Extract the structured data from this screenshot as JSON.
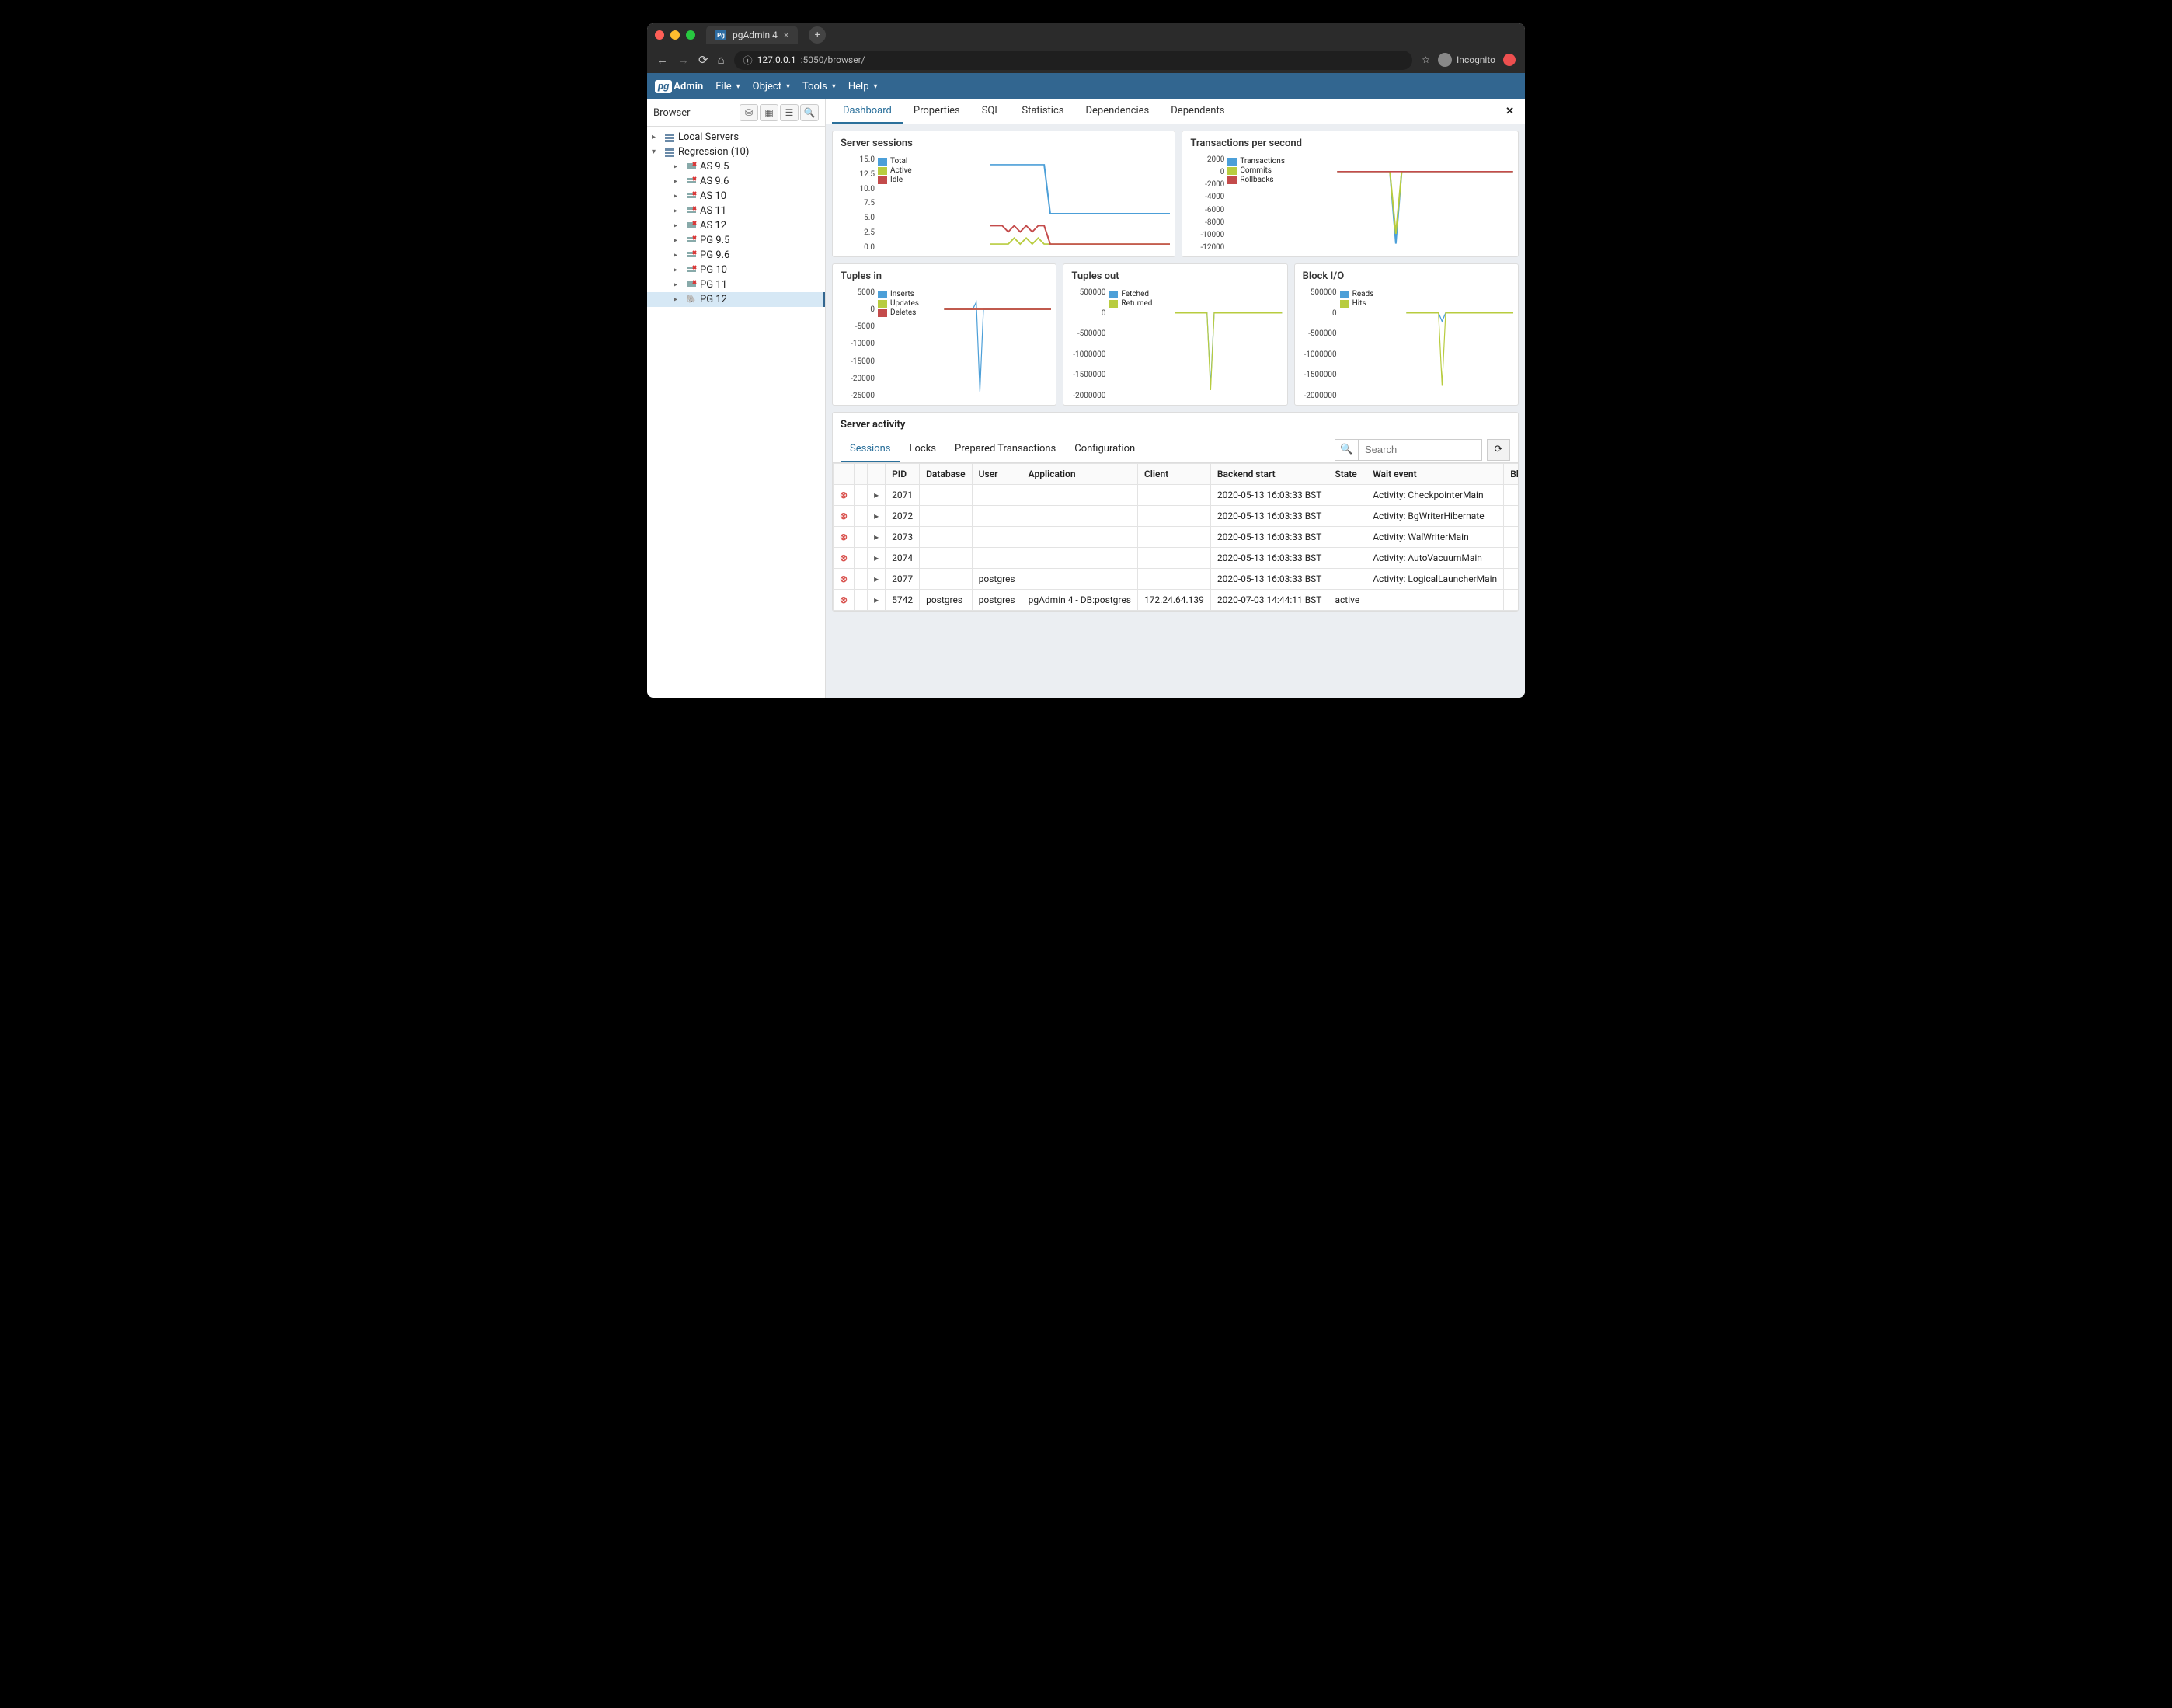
{
  "browser": {
    "tab_title": "pgAdmin 4",
    "url_display_prefix": "127.0.0.1",
    "url_display_suffix": ":5050/browser/",
    "incognito_label": "Incognito"
  },
  "appbar": {
    "brand_pg": "pg",
    "brand_admin": "Admin",
    "menus": [
      "File",
      "Object",
      "Tools",
      "Help"
    ]
  },
  "sidebar": {
    "title": "Browser",
    "tree": [
      {
        "label": "Local Servers",
        "indent": 0,
        "expanded": false,
        "icon": "group"
      },
      {
        "label": "Regression (10)",
        "indent": 0,
        "expanded": true,
        "icon": "group"
      },
      {
        "label": "AS 9.5",
        "indent": 2,
        "icon": "server-off"
      },
      {
        "label": "AS 9.6",
        "indent": 2,
        "icon": "server-off"
      },
      {
        "label": "AS 10",
        "indent": 2,
        "icon": "server-off"
      },
      {
        "label": "AS 11",
        "indent": 2,
        "icon": "server-off"
      },
      {
        "label": "AS 12",
        "indent": 2,
        "icon": "server-off"
      },
      {
        "label": "PG 9.5",
        "indent": 2,
        "icon": "server-off"
      },
      {
        "label": "PG 9.6",
        "indent": 2,
        "icon": "server-off"
      },
      {
        "label": "PG 10",
        "indent": 2,
        "icon": "server-off"
      },
      {
        "label": "PG 11",
        "indent": 2,
        "icon": "server-off"
      },
      {
        "label": "PG 12",
        "indent": 2,
        "icon": "elephant",
        "selected": true
      }
    ]
  },
  "main_tabs": [
    "Dashboard",
    "Properties",
    "SQL",
    "Statistics",
    "Dependencies",
    "Dependents"
  ],
  "charts": {
    "sessions": {
      "title": "Server sessions",
      "legend": [
        {
          "label": "Total",
          "color": "#4c9fd8"
        },
        {
          "label": "Active",
          "color": "#b8cc3f"
        },
        {
          "label": "Idle",
          "color": "#c44b4b"
        }
      ],
      "yticks": [
        "15.0",
        "12.5",
        "10.0",
        "7.5",
        "5.0",
        "2.5",
        "0.0"
      ]
    },
    "tps": {
      "title": "Transactions per second",
      "legend": [
        {
          "label": "Transactions",
          "color": "#4c9fd8"
        },
        {
          "label": "Commits",
          "color": "#b8cc3f"
        },
        {
          "label": "Rollbacks",
          "color": "#c44b4b"
        }
      ],
      "yticks": [
        "2000",
        "0",
        "-2000",
        "-4000",
        "-6000",
        "-8000",
        "-10000",
        "-12000"
      ]
    },
    "tin": {
      "title": "Tuples in",
      "legend": [
        {
          "label": "Inserts",
          "color": "#4c9fd8"
        },
        {
          "label": "Updates",
          "color": "#b8cc3f"
        },
        {
          "label": "Deletes",
          "color": "#c44b4b"
        }
      ],
      "yticks": [
        "5000",
        "0",
        "-5000",
        "-10000",
        "-15000",
        "-20000",
        "-25000"
      ]
    },
    "tout": {
      "title": "Tuples out",
      "legend": [
        {
          "label": "Fetched",
          "color": "#4c9fd8"
        },
        {
          "label": "Returned",
          "color": "#b8cc3f"
        }
      ],
      "yticks": [
        "500000",
        "0",
        "-500000",
        "-1000000",
        "-1500000",
        "-2000000"
      ]
    },
    "bio": {
      "title": "Block I/O",
      "legend": [
        {
          "label": "Reads",
          "color": "#4c9fd8"
        },
        {
          "label": "Hits",
          "color": "#b8cc3f"
        }
      ],
      "yticks": [
        "500000",
        "0",
        "-500000",
        "-1000000",
        "-1500000",
        "-2000000"
      ]
    }
  },
  "chart_data": [
    {
      "type": "line",
      "title": "Server sessions",
      "xlabel": "",
      "ylabel": "",
      "ylim": [
        0,
        15
      ],
      "series": [
        {
          "name": "Total",
          "color": "#4c9fd8",
          "values": [
            null,
            null,
            null,
            null,
            null,
            null,
            null,
            null,
            null,
            null,
            null,
            null,
            null,
            null,
            null,
            null,
            null,
            null,
            null,
            14,
            14,
            14,
            14,
            14,
            14,
            14,
            14,
            14,
            14,
            6,
            6,
            6,
            6,
            6,
            6,
            6,
            6,
            6,
            6,
            6,
            6,
            6,
            6,
            6,
            6,
            6,
            6,
            6,
            6,
            6
          ]
        },
        {
          "name": "Active",
          "color": "#b8cc3f",
          "values": [
            null,
            null,
            null,
            null,
            null,
            null,
            null,
            null,
            null,
            null,
            null,
            null,
            null,
            null,
            null,
            null,
            null,
            null,
            null,
            1,
            1,
            1,
            1,
            2,
            1,
            2,
            1,
            2,
            1,
            1,
            1,
            1,
            1,
            1,
            1,
            1,
            1,
            1,
            1,
            1,
            1,
            1,
            1,
            1,
            1,
            1,
            1,
            1,
            1,
            1
          ]
        },
        {
          "name": "Idle",
          "color": "#c44b4b",
          "values": [
            null,
            null,
            null,
            null,
            null,
            null,
            null,
            null,
            null,
            null,
            null,
            null,
            null,
            null,
            null,
            null,
            null,
            null,
            null,
            4,
            4,
            4,
            3,
            4,
            3,
            4,
            3,
            4,
            4,
            1,
            1,
            1,
            1,
            1,
            1,
            1,
            1,
            1,
            1,
            1,
            1,
            1,
            1,
            1,
            1,
            1,
            1,
            1,
            1,
            1
          ]
        }
      ]
    },
    {
      "type": "line",
      "title": "Transactions per second",
      "xlabel": "",
      "ylabel": "",
      "ylim": [
        -12000,
        2000
      ],
      "series": [
        {
          "name": "Transactions",
          "color": "#4c9fd8",
          "values": [
            null,
            null,
            null,
            null,
            null,
            null,
            null,
            null,
            null,
            null,
            null,
            null,
            null,
            null,
            null,
            null,
            null,
            null,
            null,
            0,
            0,
            0,
            0,
            0,
            0,
            0,
            0,
            0,
            0,
            -11000,
            0,
            0,
            0,
            0,
            0,
            0,
            0,
            0,
            0,
            0,
            0,
            0,
            0,
            0,
            0,
            0,
            0,
            0,
            0,
            0
          ]
        },
        {
          "name": "Commits",
          "color": "#b8cc3f",
          "values": [
            null,
            null,
            null,
            null,
            null,
            null,
            null,
            null,
            null,
            null,
            null,
            null,
            null,
            null,
            null,
            null,
            null,
            null,
            null,
            0,
            0,
            0,
            0,
            0,
            0,
            0,
            0,
            0,
            0,
            -9500,
            0,
            0,
            0,
            0,
            0,
            0,
            0,
            0,
            0,
            0,
            0,
            0,
            0,
            0,
            0,
            0,
            0,
            0,
            0,
            0
          ]
        },
        {
          "name": "Rollbacks",
          "color": "#c44b4b",
          "values": [
            null,
            null,
            null,
            null,
            null,
            null,
            null,
            null,
            null,
            null,
            null,
            null,
            null,
            null,
            null,
            null,
            null,
            null,
            null,
            0,
            0,
            0,
            0,
            0,
            0,
            0,
            0,
            0,
            0,
            0,
            0,
            0,
            0,
            0,
            0,
            0,
            0,
            0,
            0,
            0,
            0,
            0,
            0,
            0,
            0,
            0,
            0,
            0,
            0,
            0
          ]
        }
      ]
    },
    {
      "type": "line",
      "title": "Tuples in",
      "xlabel": "",
      "ylabel": "",
      "ylim": [
        -25000,
        5000
      ],
      "series": [
        {
          "name": "Inserts",
          "color": "#4c9fd8",
          "values": [
            null,
            null,
            null,
            null,
            null,
            null,
            null,
            null,
            null,
            null,
            null,
            null,
            null,
            null,
            null,
            null,
            null,
            null,
            null,
            0,
            0,
            0,
            0,
            0,
            0,
            0,
            0,
            0,
            2000,
            -23000,
            0,
            0,
            0,
            0,
            0,
            0,
            0,
            0,
            0,
            0,
            0,
            0,
            0,
            0,
            0,
            0,
            0,
            0,
            0,
            0
          ]
        },
        {
          "name": "Updates",
          "color": "#b8cc3f",
          "values": [
            null,
            null,
            null,
            null,
            null,
            null,
            null,
            null,
            null,
            null,
            null,
            null,
            null,
            null,
            null,
            null,
            null,
            null,
            null,
            0,
            0,
            0,
            0,
            0,
            0,
            0,
            0,
            0,
            0,
            0,
            0,
            0,
            0,
            0,
            0,
            0,
            0,
            0,
            0,
            0,
            0,
            0,
            0,
            0,
            0,
            0,
            0,
            0,
            0,
            0
          ]
        },
        {
          "name": "Deletes",
          "color": "#c44b4b",
          "values": [
            null,
            null,
            null,
            null,
            null,
            null,
            null,
            null,
            null,
            null,
            null,
            null,
            null,
            null,
            null,
            null,
            null,
            null,
            null,
            0,
            0,
            0,
            0,
            0,
            0,
            0,
            0,
            0,
            0,
            0,
            0,
            0,
            0,
            0,
            0,
            0,
            0,
            0,
            0,
            0,
            0,
            0,
            0,
            0,
            0,
            0,
            0,
            0,
            0,
            0
          ]
        }
      ]
    },
    {
      "type": "line",
      "title": "Tuples out",
      "xlabel": "",
      "ylabel": "",
      "ylim": [
        -2000000,
        500000
      ],
      "series": [
        {
          "name": "Fetched",
          "color": "#4c9fd8",
          "values": [
            null,
            null,
            null,
            null,
            null,
            null,
            null,
            null,
            null,
            null,
            null,
            null,
            null,
            null,
            null,
            null,
            null,
            null,
            null,
            0,
            0,
            0,
            0,
            0,
            0,
            0,
            0,
            0,
            0,
            -1700000,
            0,
            0,
            0,
            0,
            0,
            0,
            0,
            0,
            0,
            0,
            0,
            0,
            0,
            0,
            0,
            0,
            0,
            0,
            0,
            0
          ]
        },
        {
          "name": "Returned",
          "color": "#b8cc3f",
          "values": [
            null,
            null,
            null,
            null,
            null,
            null,
            null,
            null,
            null,
            null,
            null,
            null,
            null,
            null,
            null,
            null,
            null,
            null,
            null,
            0,
            0,
            0,
            0,
            0,
            0,
            0,
            0,
            0,
            0,
            -1800000,
            0,
            0,
            0,
            0,
            0,
            0,
            0,
            0,
            0,
            0,
            0,
            0,
            0,
            0,
            0,
            0,
            0,
            0,
            0,
            0
          ]
        }
      ]
    },
    {
      "type": "line",
      "title": "Block I/O",
      "xlabel": "",
      "ylabel": "",
      "ylim": [
        -2000000,
        500000
      ],
      "series": [
        {
          "name": "Reads",
          "color": "#4c9fd8",
          "values": [
            null,
            null,
            null,
            null,
            null,
            null,
            null,
            null,
            null,
            null,
            null,
            null,
            null,
            null,
            null,
            null,
            null,
            null,
            null,
            0,
            0,
            0,
            0,
            0,
            0,
            0,
            0,
            0,
            0,
            -200000,
            0,
            0,
            0,
            0,
            0,
            0,
            0,
            0,
            0,
            0,
            0,
            0,
            0,
            0,
            0,
            0,
            0,
            0,
            0,
            0
          ]
        },
        {
          "name": "Hits",
          "color": "#b8cc3f",
          "values": [
            null,
            null,
            null,
            null,
            null,
            null,
            null,
            null,
            null,
            null,
            null,
            null,
            null,
            null,
            null,
            null,
            null,
            null,
            null,
            0,
            0,
            0,
            0,
            0,
            0,
            0,
            0,
            0,
            0,
            -1700000,
            0,
            0,
            0,
            0,
            0,
            0,
            0,
            0,
            0,
            0,
            0,
            0,
            0,
            0,
            0,
            0,
            0,
            0,
            0,
            0
          ]
        }
      ]
    }
  ],
  "activity": {
    "title": "Server activity",
    "subtabs": [
      "Sessions",
      "Locks",
      "Prepared Transactions",
      "Configuration"
    ],
    "search_placeholder": "Search",
    "columns": [
      "",
      "",
      "",
      "PID",
      "Database",
      "User",
      "Application",
      "Client",
      "Backend start",
      "State",
      "Wait event",
      "Blocking PIDs"
    ],
    "rows": [
      {
        "pid": "2071",
        "database": "",
        "user": "",
        "application": "",
        "client": "",
        "backend_start": "2020-05-13 16:03:33 BST",
        "state": "",
        "wait_event": "Activity: CheckpointerMain",
        "blocking": ""
      },
      {
        "pid": "2072",
        "database": "",
        "user": "",
        "application": "",
        "client": "",
        "backend_start": "2020-05-13 16:03:33 BST",
        "state": "",
        "wait_event": "Activity: BgWriterHibernate",
        "blocking": ""
      },
      {
        "pid": "2073",
        "database": "",
        "user": "",
        "application": "",
        "client": "",
        "backend_start": "2020-05-13 16:03:33 BST",
        "state": "",
        "wait_event": "Activity: WalWriterMain",
        "blocking": ""
      },
      {
        "pid": "2074",
        "database": "",
        "user": "",
        "application": "",
        "client": "",
        "backend_start": "2020-05-13 16:03:33 BST",
        "state": "",
        "wait_event": "Activity: AutoVacuumMain",
        "blocking": ""
      },
      {
        "pid": "2077",
        "database": "",
        "user": "postgres",
        "application": "",
        "client": "",
        "backend_start": "2020-05-13 16:03:33 BST",
        "state": "",
        "wait_event": "Activity: LogicalLauncherMain",
        "blocking": ""
      },
      {
        "pid": "5742",
        "database": "postgres",
        "user": "postgres",
        "application": "pgAdmin 4 - DB:postgres",
        "client": "172.24.64.139",
        "backend_start": "2020-07-03 14:44:11 BST",
        "state": "active",
        "wait_event": "",
        "blocking": ""
      }
    ]
  }
}
